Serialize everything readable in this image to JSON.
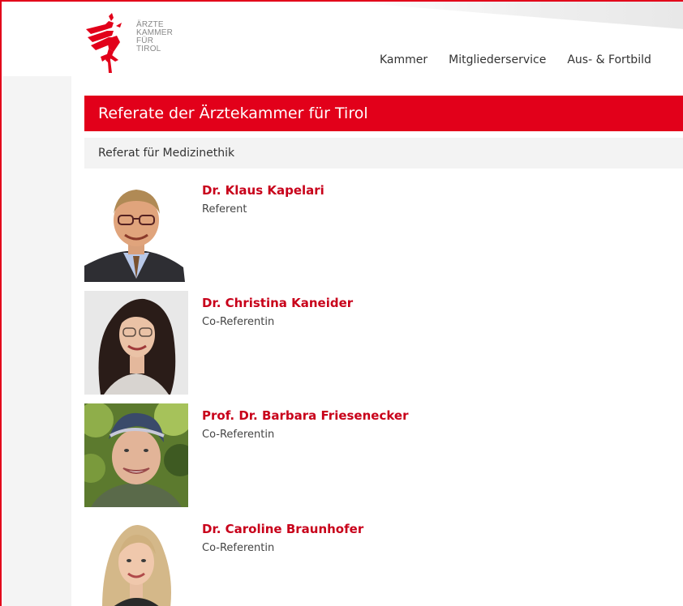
{
  "logo": {
    "lines": [
      "ÄRZTE",
      "KAMMER",
      "FÜR",
      "TIROL"
    ],
    "brand_color": "#e2001a"
  },
  "nav": {
    "items": [
      "Kammer",
      "Mitgliederservice",
      "Aus- & Fortbild"
    ]
  },
  "page": {
    "title": "Referate der Ärztekammer für Tirol"
  },
  "section": {
    "title": "Referat für Medizinethik"
  },
  "people": [
    {
      "name": "Dr. Klaus Kapelari",
      "role": "Referent"
    },
    {
      "name": "Dr. Christina Kaneider",
      "role": "Co-Referentin"
    },
    {
      "name": "Prof. Dr. Barbara Friesenecker",
      "role": "Co-Referentin"
    },
    {
      "name": "Dr. Caroline Braunhofer",
      "role": "Co-Referentin"
    }
  ],
  "colors": {
    "accent": "#e2001a",
    "name_link": "#c8001a",
    "section_bg": "#f3f3f3"
  }
}
